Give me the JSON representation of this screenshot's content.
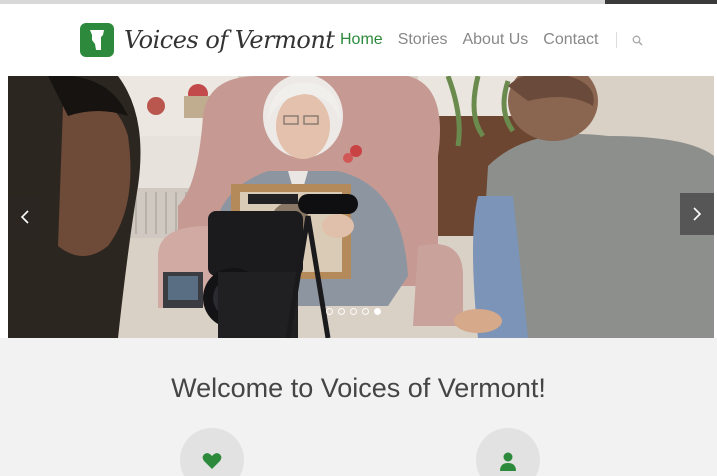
{
  "brand": {
    "name": "Voices of Vermont",
    "accent_color": "#2d8a3c",
    "logo_icon": "vermont-state-icon"
  },
  "nav": {
    "items": [
      {
        "label": "Home",
        "active": true
      },
      {
        "label": "Stories",
        "active": false
      },
      {
        "label": "About Us",
        "active": false
      },
      {
        "label": "Contact",
        "active": false
      }
    ],
    "search_icon": "search-icon"
  },
  "slider": {
    "prev_icon": "chevron-left-icon",
    "next_icon": "chevron-right-icon",
    "slide_count": 5,
    "active_slide": 5
  },
  "welcome": {
    "title": "Welcome to Voices of Vermont!",
    "features": [
      {
        "icon": "heart-icon"
      },
      {
        "icon": "user-icon"
      }
    ]
  }
}
